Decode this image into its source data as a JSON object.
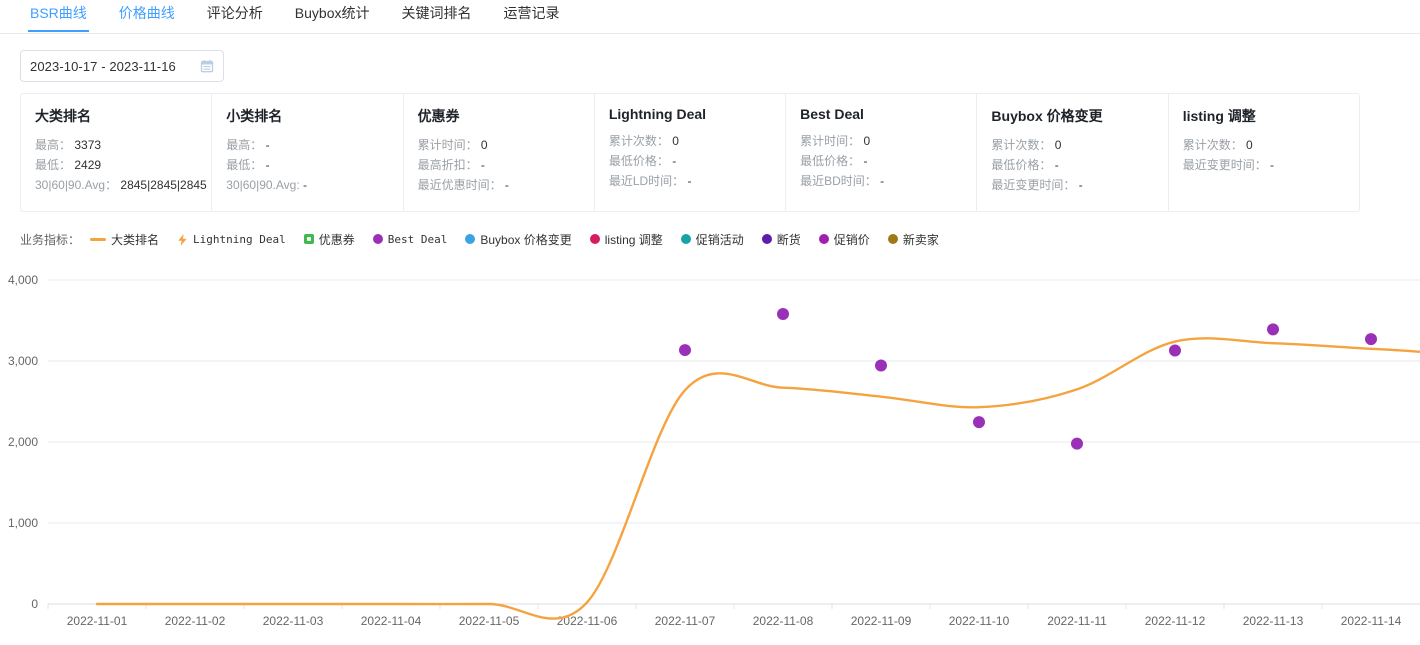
{
  "tabs": [
    {
      "label": "BSR曲线",
      "active": true
    },
    {
      "label": "价格曲线",
      "active": false,
      "blue": true
    },
    {
      "label": "评论分析",
      "active": false
    },
    {
      "label": "Buybox统计",
      "active": false
    },
    {
      "label": "关键词排名",
      "active": false
    },
    {
      "label": "运营记录",
      "active": false
    }
  ],
  "datepicker": {
    "value": "2023-10-17 - 2023-11-16",
    "icon": "calendar-icon"
  },
  "cards": [
    {
      "title": "大类排名",
      "rows": [
        {
          "label": "最高：",
          "value": "3373"
        },
        {
          "label": "最低：",
          "value": "2429"
        },
        {
          "label": "30|60|90.Avg：",
          "value": "2845|2845|2845"
        }
      ]
    },
    {
      "title": "小类排名",
      "rows": [
        {
          "label": "最高：",
          "value": "-"
        },
        {
          "label": "最低：",
          "value": "-"
        },
        {
          "label": "30|60|90.Avg:",
          "value": "-"
        }
      ]
    },
    {
      "title": "优惠券",
      "rows": [
        {
          "label": "累计时间：",
          "value": "0"
        },
        {
          "label": "最高折扣：",
          "value": "-"
        },
        {
          "label": "最近优惠时间：",
          "value": "-"
        }
      ]
    },
    {
      "title": "Lightning Deal",
      "rows": [
        {
          "label": "累计次数：",
          "value": "0"
        },
        {
          "label": "最低价格：",
          "value": "-"
        },
        {
          "label": "最近LD时间：",
          "value": "-"
        }
      ]
    },
    {
      "title": "Best Deal",
      "rows": [
        {
          "label": "累计时间：",
          "value": "0"
        },
        {
          "label": "最低价格：",
          "value": "-"
        },
        {
          "label": "最近BD时间：",
          "value": "-"
        }
      ]
    },
    {
      "title": "Buybox 价格变更",
      "rows": [
        {
          "label": "累计次数：",
          "value": "0"
        },
        {
          "label": "最低价格：",
          "value": "-"
        },
        {
          "label": "最近变更时间：",
          "value": "-"
        }
      ]
    },
    {
      "title": "listing 调整",
      "rows": [
        {
          "label": "累计次数：",
          "value": "0"
        },
        {
          "label": "最近变更时间：",
          "value": "-"
        }
      ]
    }
  ],
  "legend": {
    "label": "业务指标：",
    "items": [
      {
        "name": "大类排名",
        "marker": "line",
        "color": "#f5a340",
        "mono": false
      },
      {
        "name": "Lightning Deal",
        "marker": "bolt",
        "color": "#f5a340",
        "mono": true
      },
      {
        "name": "优惠券",
        "marker": "square",
        "color": "#3fb950",
        "mono": false
      },
      {
        "name": "Best Deal",
        "marker": "dot",
        "color": "#9b30b8",
        "mono": true
      },
      {
        "name": "Buybox 价格变更",
        "marker": "dot",
        "color": "#3aa3e3",
        "mono": false
      },
      {
        "name": "listing 调整",
        "marker": "dot",
        "color": "#d81b60",
        "mono": false
      },
      {
        "name": "促销活动",
        "marker": "dot",
        "color": "#17a2a8",
        "mono": false
      },
      {
        "name": "断货",
        "marker": "dot",
        "color": "#5b1fa8",
        "mono": false
      },
      {
        "name": "促销价",
        "marker": "dot",
        "color": "#a01fb0",
        "mono": false
      },
      {
        "name": "新卖家",
        "marker": "dot",
        "color": "#a07818",
        "mono": false
      }
    ]
  },
  "chart_data": {
    "type": "line",
    "title": "",
    "xlabel": "",
    "ylabel": "",
    "ylim": [
      0,
      4000
    ],
    "yticks": [
      0,
      1000,
      2000,
      3000,
      4000
    ],
    "yticklabels": [
      "0",
      "1,000",
      "2,000",
      "3,000",
      "4,000"
    ],
    "grid": true,
    "legend_position": "top-left",
    "x": [
      "2022-11-01",
      "2022-11-02",
      "2022-11-03",
      "2022-11-04",
      "2022-11-05",
      "2022-11-06",
      "2022-11-07",
      "2022-11-08",
      "2022-11-09",
      "2022-11-10",
      "2022-11-11",
      "2022-11-12",
      "2022-11-13",
      "2022-11-14"
    ],
    "series": [
      {
        "name": "大类排名",
        "type": "line",
        "color": "#f5a340",
        "smooth": true,
        "values": [
          0,
          0,
          0,
          0,
          0,
          20,
          2640,
          2670,
          2560,
          2430,
          2650,
          3240,
          3220,
          3150
        ]
      },
      {
        "name": "Best Deal",
        "type": "scatter",
        "color": "#9b30b8",
        "points": [
          {
            "x": "2022-11-07",
            "y": 3135
          },
          {
            "x": "2022-11-08",
            "y": 3580
          },
          {
            "x": "2022-11-09",
            "y": 2945
          },
          {
            "x": "2022-11-10",
            "y": 2245
          },
          {
            "x": "2022-11-11",
            "y": 1980
          },
          {
            "x": "2022-11-12",
            "y": 3130
          },
          {
            "x": "2022-11-13",
            "y": 3390
          },
          {
            "x": "2022-11-14",
            "y": 3270
          }
        ]
      }
    ]
  }
}
